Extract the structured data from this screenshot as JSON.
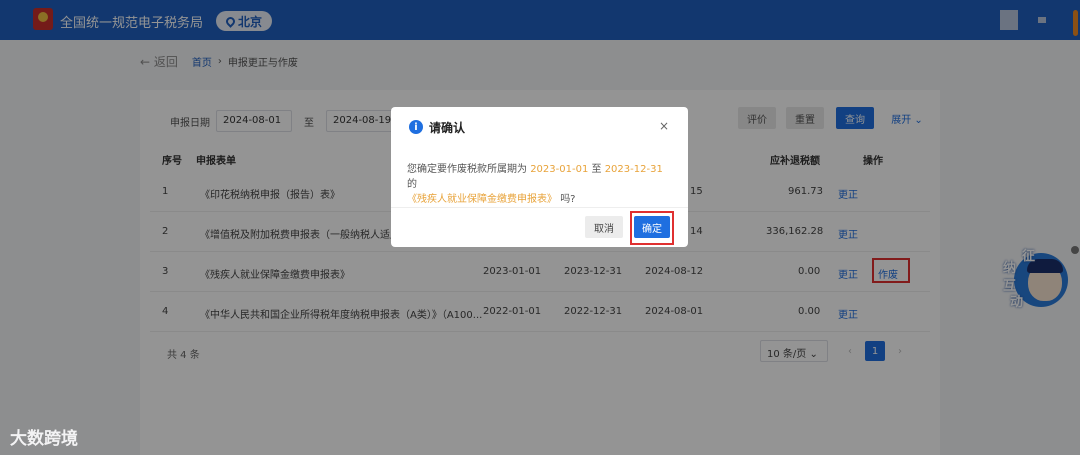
{
  "header": {
    "site_title": "全国统一规范电子税务局",
    "location": "北京"
  },
  "breadcrumb": {
    "back": "← 返回",
    "home": "首页",
    "separator": "›",
    "current": "申报更正与作废"
  },
  "filter": {
    "label": "申报日期",
    "date_from": "2024-08-01",
    "to": "至",
    "date_to": "2024-08-19",
    "evaluate_button": "评价",
    "reset_button": "重置",
    "search_button": "查询",
    "expand_link": "展开 ⌄"
  },
  "table": {
    "headers": {
      "index": "序号",
      "form": "申报表单",
      "amount": "应补退税额",
      "action": "操作"
    },
    "rows": [
      {
        "index": "1",
        "form": "《印花税纳税申报（报告）表》",
        "start": "",
        "end": "",
        "date": "15",
        "amount": "961.73",
        "action1": "更正",
        "action2": ""
      },
      {
        "index": "2",
        "form": "《增值税及附加税费申报表（一般纳税人适用）",
        "start": "",
        "end": "",
        "date": "14",
        "amount": "336,162.28",
        "action1": "更正",
        "action2": ""
      },
      {
        "index": "3",
        "form": "《残疾人就业保障金缴费申报表》",
        "start": "2023-01-01",
        "end": "2023-12-31",
        "date": "2024-08-12",
        "amount": "0.00",
        "action1": "更正",
        "action2": "作废"
      },
      {
        "index": "4",
        "form": "《中华人民共和国企业所得税年度纳税申报表（A类）》（A100...",
        "start": "2022-01-01",
        "end": "2022-12-31",
        "date": "2024-08-01",
        "amount": "0.00",
        "action1": "更正",
        "action2": ""
      }
    ],
    "total": "共 4 条"
  },
  "pagination": {
    "page_size": "10 条/页 ⌄",
    "prev": "‹",
    "current_page": "1",
    "next": "›"
  },
  "dialog": {
    "icon": "i",
    "title": "请确认",
    "close": "×",
    "message_prefix": "您确定要作废税款所属期为",
    "period_start": "2023-01-01",
    "to": "至",
    "period_end": "2023-12-31",
    "of": "的",
    "form_name": "《残疾人就业保障金缴费申报表》",
    "suffix": "吗?",
    "cancel": "取消",
    "confirm": "确定"
  },
  "assistant": {
    "char1": "征",
    "char2": "纳",
    "char3": "互",
    "char4": "动"
  },
  "watermark": "大数跨境",
  "colors": {
    "header_bg": "#1f5fbf",
    "primary": "#1f6fe0",
    "highlight": "#e8a33a",
    "annotation_red": "#e03030"
  }
}
